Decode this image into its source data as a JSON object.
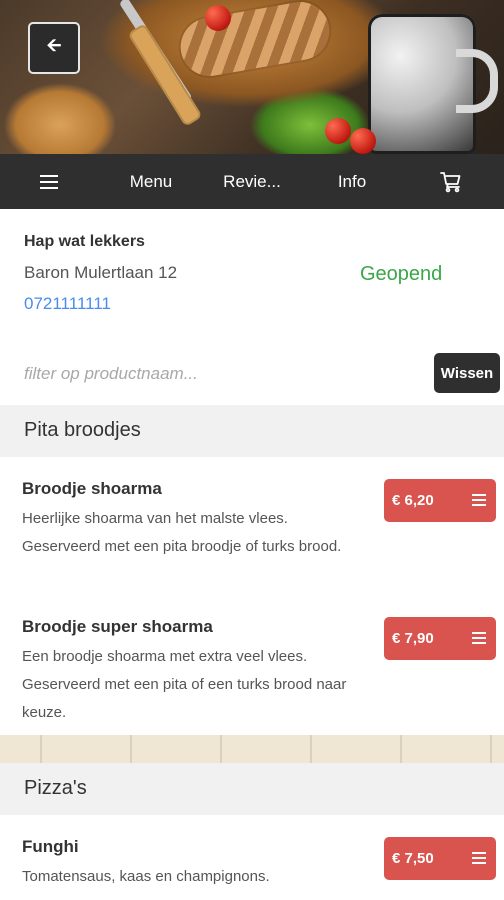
{
  "nav": {
    "back_icon": "arrow-left-icon",
    "menu_label": "Menu",
    "reviews_label": "Revie...",
    "info_label": "Info",
    "cart_icon": "cart-icon",
    "menu_icon": "hamburger-icon"
  },
  "restaurant": {
    "name": "Hap wat lekkers",
    "address": "Baron Mulertlaan 12",
    "phone": "0721111111",
    "status": "Geopend",
    "status_color": "#3aa748"
  },
  "filter": {
    "placeholder": "filter op productnaam...",
    "clear_label": "Wissen"
  },
  "categories": [
    {
      "title": "Pita broodjes",
      "products": [
        {
          "name": "Broodje shoarma",
          "description": "Heerlijke shoarma van het malste vlees. Geserveerd met een pita broodje of turks brood.",
          "price": "€ 6,20"
        },
        {
          "name": "Broodje super shoarma",
          "description": "Een broodje shoarma met extra veel vlees. Geserveerd met een pita of een turks brood naar keuze.",
          "price": "€ 7,90"
        }
      ]
    },
    {
      "title": "Pizza's",
      "products": [
        {
          "name": "Funghi",
          "description": "Tomatensaus, kaas en champignons.",
          "price": "€ 7,50"
        }
      ]
    }
  ],
  "colors": {
    "price_button": "#d9534f",
    "nav_bar": "#2f2f2f",
    "phone_link": "#4a8cf0"
  }
}
